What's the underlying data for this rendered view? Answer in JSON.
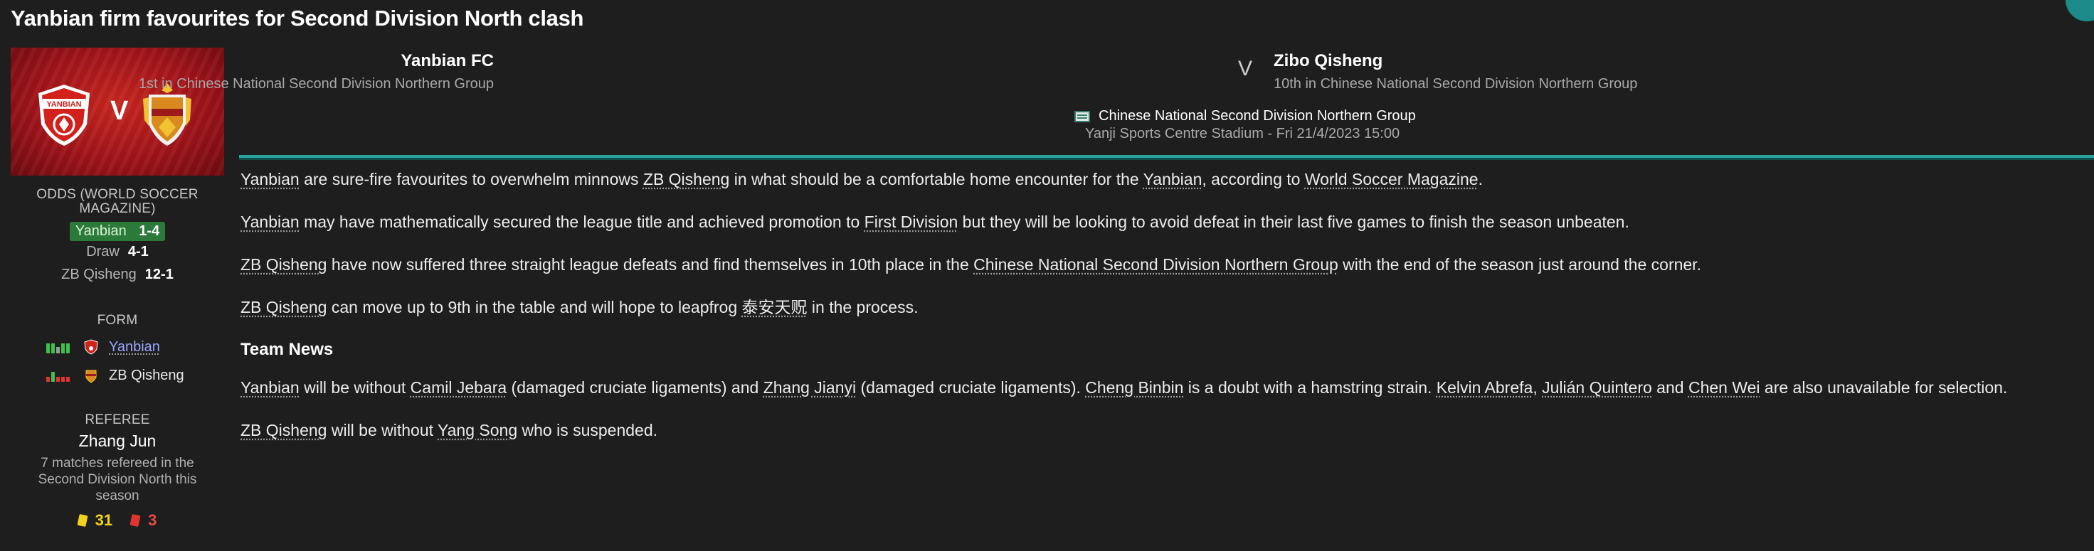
{
  "headline": "Yanbian firm favourites for Second Division North clash",
  "banner": {
    "home_crest_text": "YANBIAN",
    "vs": "V"
  },
  "odds": {
    "title": "ODDS (WORLD SOCCER MAGAZINE)",
    "rows": [
      {
        "label": "Yanbian",
        "value": "1-4"
      },
      {
        "label": "Draw",
        "value": "4-1"
      },
      {
        "label": "ZB Qisheng",
        "value": "12-1"
      }
    ]
  },
  "form": {
    "title": "FORM",
    "home": {
      "team": "Yanbian",
      "results": [
        "W",
        "W",
        "D",
        "W",
        "W"
      ]
    },
    "away": {
      "team": "ZB Qisheng",
      "results": [
        "L",
        "W",
        "L",
        "L",
        "L"
      ]
    }
  },
  "referee": {
    "title": "REFEREE",
    "name": "Zhang Jun",
    "note": "7 matches refereed in the Second Division North this season",
    "yellow": "31",
    "red": "3"
  },
  "match": {
    "home_team": "Yanbian FC",
    "home_position": "1st in Chinese National Second Division Northern Group",
    "vs": "V",
    "away_team": "Zibo Qisheng",
    "away_position": "10th in Chinese National Second Division Northern Group",
    "competition": "Chinese National Second Division Northern Group",
    "venue": "Yanji Sports Centre Stadium - Fri 21/4/2023 15:00"
  },
  "colors": {
    "accent": "#2aa39f",
    "home_primary": "#c8261f",
    "away_primary": "#d98a1e",
    "fav_odds": "#2b7a3a",
    "win": "#3cc14d",
    "draw": "#9a9a9a",
    "loss": "#e2342f"
  },
  "article": {
    "p1": {
      "a": "Yanbian",
      "b": " are sure-fire favourites to overwhelm minnows ",
      "c": "ZB Qisheng",
      "d": " in what should be a comfortable home encounter for the ",
      "e": "Yanbian",
      "f": ", according to ",
      "g": "World Soccer Magazine",
      "h": "."
    },
    "p2": {
      "a": "Yanbian",
      "b": " may have mathematically secured the league title and achieved promotion to ",
      "c": "First Division",
      "d": " but they will be looking to avoid defeat in their last five games to finish the season unbeaten."
    },
    "p3": {
      "a": "ZB Qisheng",
      "b": " have now suffered three straight league defeats and find themselves in 10th place in the ",
      "c": "Chinese National Second Division Northern Group",
      "d": " with the end of the season just around the corner."
    },
    "p4": {
      "a": "ZB Qisheng",
      "b": " can move up to 9th in the table and will hope to leapfrog ",
      "c": "泰安天贶",
      "d": " in the process."
    },
    "team_news_heading": "Team News",
    "p5": {
      "a": "Yanbian",
      "b": " will be without ",
      "c": "Camil Jebara",
      "d": " (damaged cruciate ligaments) and ",
      "e": "Zhang Jianyi",
      "f": " (damaged cruciate ligaments). ",
      "g": "Cheng Binbin",
      "h": " is a doubt with a hamstring strain. ",
      "i": "Kelvin Abrefa",
      "j": ", ",
      "k": "Julián Quintero",
      "l": " and ",
      "m": "Chen Wei",
      "n": " are also unavailable for selection."
    },
    "p6": {
      "a": "ZB Qisheng",
      "b": " will be without ",
      "c": "Yang Song",
      "d": " who is suspended."
    }
  }
}
